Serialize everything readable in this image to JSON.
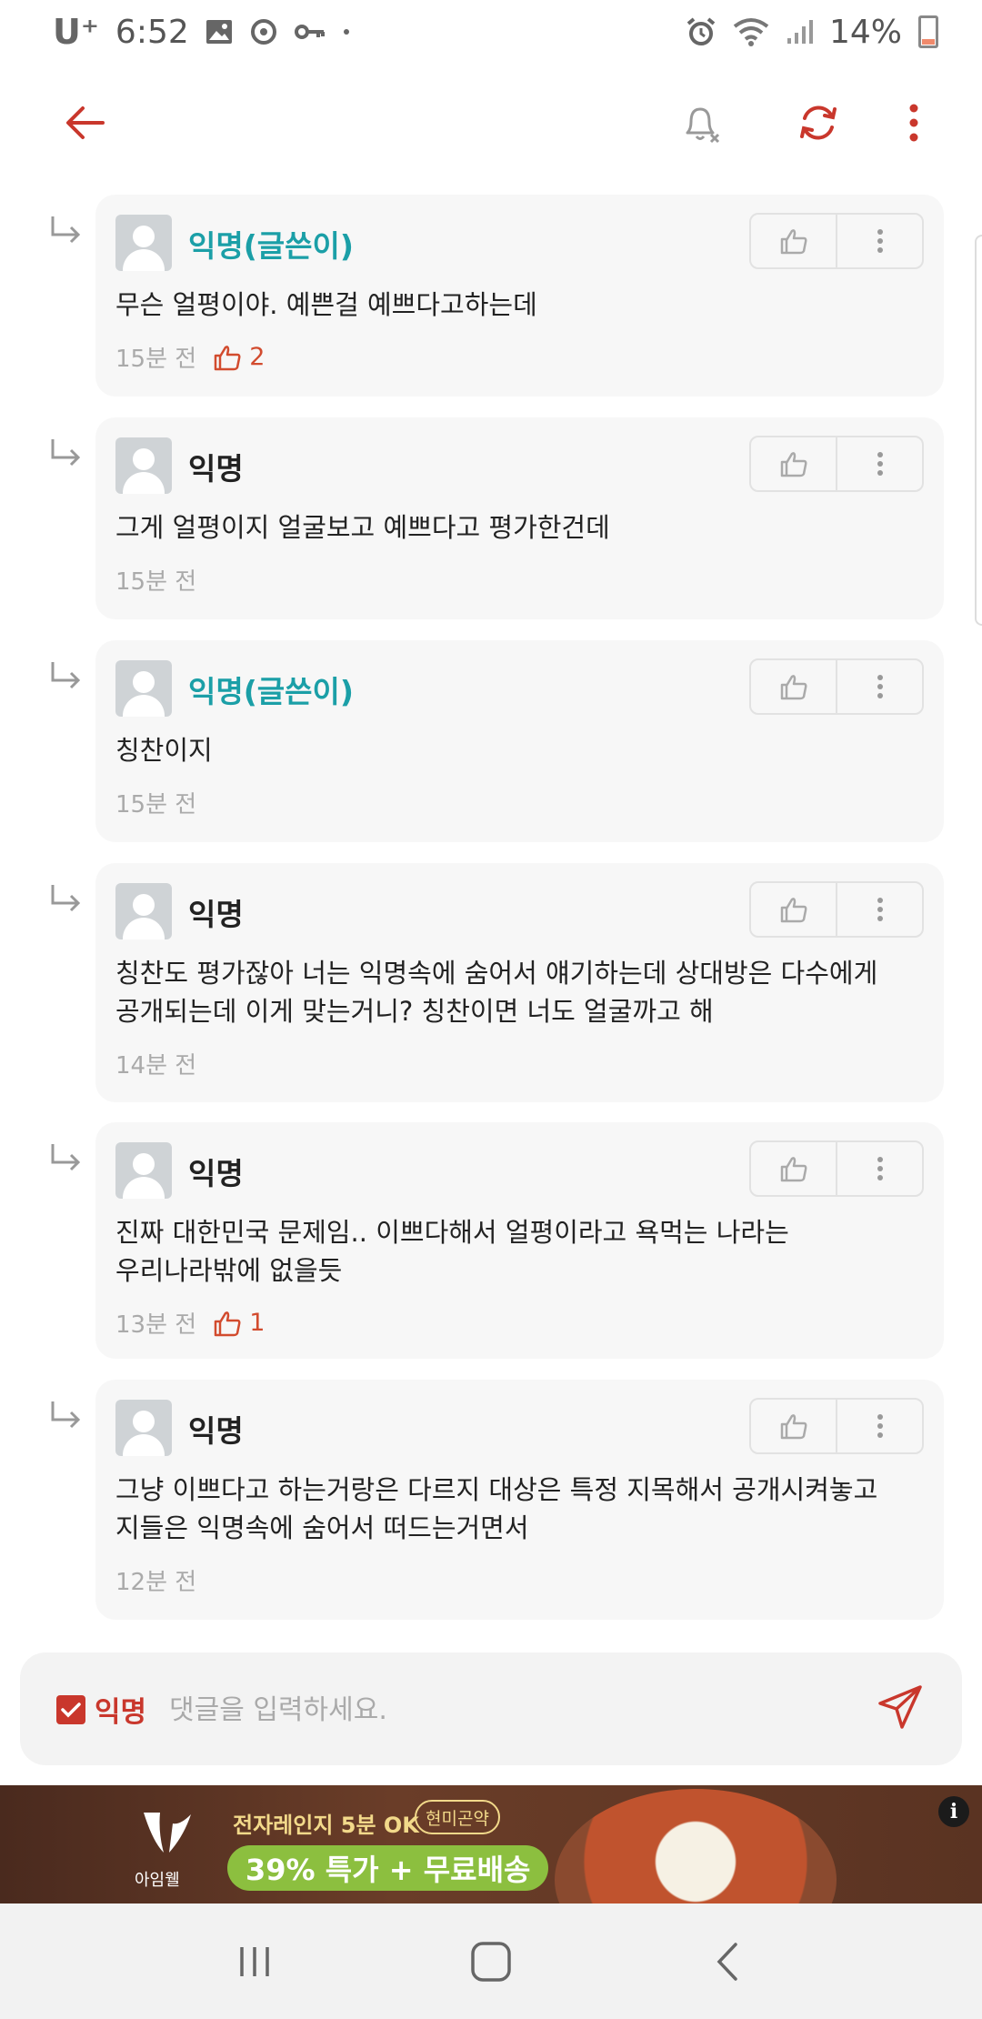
{
  "status_bar": {
    "carrier": "U⁺",
    "time": "6:52",
    "battery": "14%"
  },
  "toolbar": {
    "back_icon": "back-arrow-icon",
    "notify_icon": "bell-off-icon",
    "refresh_icon": "refresh-icon",
    "more_icon": "more-vertical-icon"
  },
  "comments": [
    {
      "author": "익명(글쓴이)",
      "is_op": true,
      "text": "무슨 얼평이야. 예쁜걸 예쁘다고하는데",
      "time": "15분 전",
      "likes": "2"
    },
    {
      "author": "익명",
      "is_op": false,
      "text": "그게 얼평이지 얼굴보고 예쁘다고 평가한건데",
      "time": "15분 전",
      "likes": ""
    },
    {
      "author": "익명(글쓴이)",
      "is_op": true,
      "text": "칭찬이지",
      "time": "15분 전",
      "likes": ""
    },
    {
      "author": "익명",
      "is_op": false,
      "text": "칭찬도 평가잖아 너는 익명속에 숨어서 얘기하는데 상대방은 다수에게\n공개되는데 이게 맞는거니? 칭찬이면 너도 얼굴까고 해",
      "time": "14분 전",
      "likes": ""
    },
    {
      "author": "익명",
      "is_op": false,
      "text": "진짜 대한민국 문제임.. 이쁘다해서 얼평이라고 욕먹는 나라는\n우리나라밖에 없을듯",
      "time": "13분 전",
      "likes": "1"
    },
    {
      "author": "익명",
      "is_op": false,
      "text": "그냥 이쁘다고 하는거랑은 다르지 대상은 특정 지목해서 공개시켜놓고\n지들은 익명속에 숨어서 떠드는거면서",
      "time": "12분 전",
      "likes": ""
    }
  ],
  "input_bar": {
    "anon_label": "익명",
    "anon_checked": true,
    "placeholder": "댓글을 입력하세요.",
    "value": ""
  },
  "ad": {
    "brand": "아임웰",
    "line1": "전자레인지 5분 OK",
    "badge": "현미곤약",
    "promo": "39% 특가 + 무료배송",
    "info": "i"
  },
  "colors": {
    "accent": "#c9372c",
    "op_author": "#1b9fa7",
    "card_bg": "#f7f7f7"
  }
}
